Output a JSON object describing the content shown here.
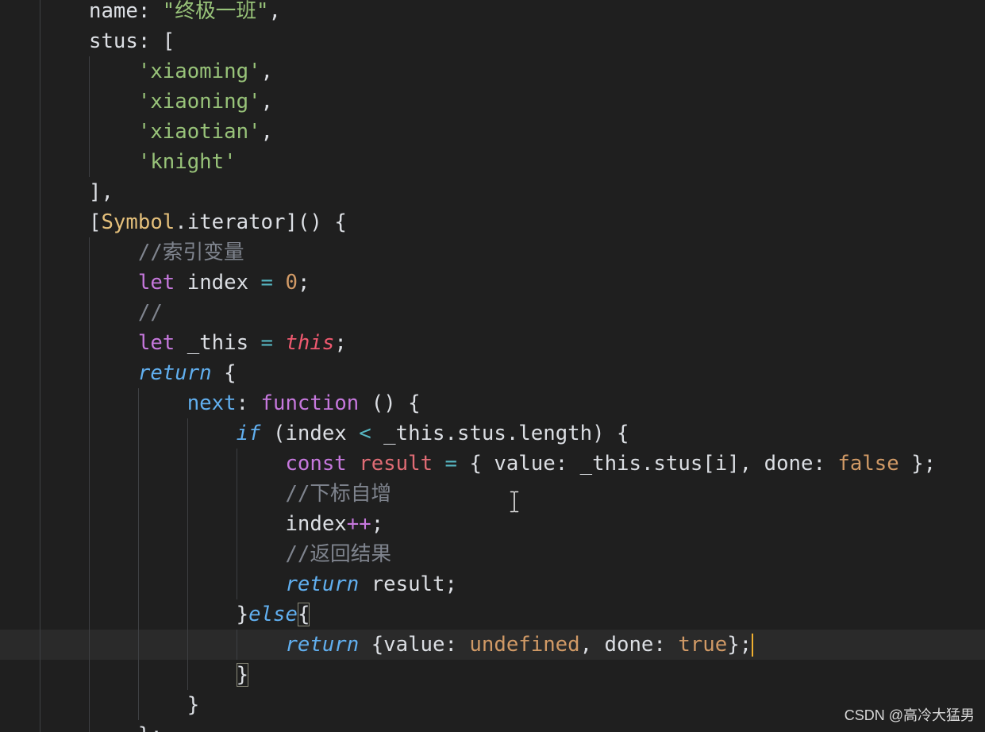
{
  "editor": {
    "theme": {
      "background": "#1f1f1f",
      "foreground": "#dcdfe4",
      "current_line": "#2a2a2a",
      "indent_guide": "#3e4043",
      "caret": "#f0b030",
      "bracket_match_border": "#8b8b7a"
    },
    "lines": [
      {
        "tokens": [
          {
            "t": "name: "
          },
          {
            "t": "\"终极一班\"",
            "c": "#98c379"
          },
          {
            "t": ","
          }
        ]
      },
      {
        "tokens": [
          {
            "t": "stus: ["
          }
        ]
      },
      {
        "tokens": [
          {
            "t": "    'xiaoming'",
            "c": "#98c379"
          },
          {
            "t": ","
          }
        ]
      },
      {
        "tokens": [
          {
            "t": "    'xiaoning'",
            "c": "#98c379"
          },
          {
            "t": ","
          }
        ]
      },
      {
        "tokens": [
          {
            "t": "    'xiaotian'",
            "c": "#98c379"
          },
          {
            "t": ","
          }
        ]
      },
      {
        "tokens": [
          {
            "t": "    'knight'",
            "c": "#98c379"
          }
        ]
      },
      {
        "tokens": [
          {
            "t": "],"
          }
        ]
      },
      {
        "tokens": [
          {
            "t": "["
          },
          {
            "t": "Symbol",
            "c": "#e5c07b"
          },
          {
            "t": ".iterator]() {"
          }
        ]
      },
      {
        "tokens": [
          {
            "t": "    //索引变量",
            "c": "#7f848e"
          }
        ]
      },
      {
        "tokens": [
          {
            "t": "    let",
            "c": "#c678dd"
          },
          {
            "t": " index "
          },
          {
            "t": "=",
            "c": "#56b6c2"
          },
          {
            "t": " "
          },
          {
            "t": "0",
            "c": "#d19a66"
          },
          {
            "t": ";"
          }
        ]
      },
      {
        "tokens": [
          {
            "t": "    //",
            "c": "#7f848e"
          }
        ]
      },
      {
        "tokens": [
          {
            "t": "    let",
            "c": "#c678dd"
          },
          {
            "t": " _this "
          },
          {
            "t": "=",
            "c": "#56b6c2"
          },
          {
            "t": " "
          },
          {
            "t": "this",
            "c": "#ef596f",
            "i": true
          },
          {
            "t": ";"
          }
        ]
      },
      {
        "tokens": [
          {
            "t": "    return",
            "c": "#61afef",
            "i": true
          },
          {
            "t": " {"
          }
        ]
      },
      {
        "tokens": [
          {
            "t": "        next",
            "c": "#61afef"
          },
          {
            "t": ": "
          },
          {
            "t": "function",
            "c": "#c678dd"
          },
          {
            "t": " () {"
          }
        ]
      },
      {
        "tokens": [
          {
            "t": "            if",
            "c": "#61afef",
            "i": true
          },
          {
            "t": " (index "
          },
          {
            "t": "<",
            "c": "#56b6c2"
          },
          {
            "t": " _this.stus.length) {"
          }
        ]
      },
      {
        "tokens": [
          {
            "t": "                const",
            "c": "#c678dd"
          },
          {
            "t": " "
          },
          {
            "t": "result",
            "c": "#e06c75"
          },
          {
            "t": " "
          },
          {
            "t": "=",
            "c": "#56b6c2"
          },
          {
            "t": " { value: _this.stus[i], done: "
          },
          {
            "t": "false",
            "c": "#d19a66"
          },
          {
            "t": " };"
          }
        ]
      },
      {
        "tokens": [
          {
            "t": "                //下标自增",
            "c": "#7f848e"
          }
        ]
      },
      {
        "tokens": [
          {
            "t": "                index"
          },
          {
            "t": "++",
            "c": "#c678dd"
          },
          {
            "t": ";"
          }
        ]
      },
      {
        "tokens": [
          {
            "t": "                //返回结果",
            "c": "#7f848e"
          }
        ]
      },
      {
        "tokens": [
          {
            "t": "                return",
            "c": "#61afef",
            "i": true
          },
          {
            "t": " result;"
          }
        ]
      },
      {
        "tokens": [
          {
            "t": "            }"
          },
          {
            "t": "else",
            "c": "#61afef",
            "i": true
          },
          {
            "t": "{",
            "box": true
          }
        ]
      },
      {
        "tokens": [
          {
            "t": "                return",
            "c": "#61afef",
            "i": true
          },
          {
            "t": " {value: "
          },
          {
            "t": "undefined",
            "c": "#d19a66"
          },
          {
            "t": ", done: "
          },
          {
            "t": "true",
            "c": "#d19a66"
          },
          {
            "t": "};"
          }
        ],
        "current": true,
        "cursor": true
      },
      {
        "tokens": [
          {
            "t": "            "
          },
          {
            "t": "}",
            "box": true
          }
        ]
      },
      {
        "tokens": [
          {
            "t": "        }"
          }
        ]
      },
      {
        "tokens": [
          {
            "t": "    };"
          }
        ]
      }
    ]
  },
  "watermark": "CSDN @高冷大猛男"
}
